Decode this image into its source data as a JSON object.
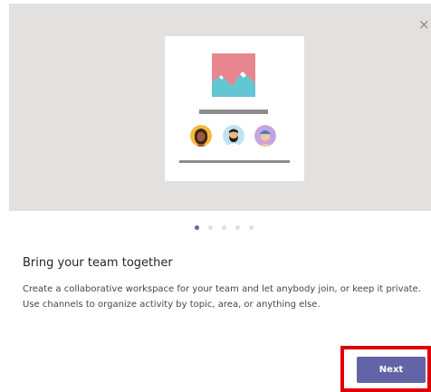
{
  "dialog": {
    "close_symbol": "×",
    "illustration": {
      "image_icon": "landscape-image-icon",
      "avatars": [
        "avatar-woman-icon",
        "avatar-bearded-man-icon",
        "avatar-man-with-cap-icon"
      ]
    },
    "pagination": {
      "total": 5,
      "current": 1
    },
    "heading": "Bring your team together",
    "body": "Create a collaborative workspace for your team and let anybody join, or keep it private. Use channels to organize activity by topic, area, or anything else.",
    "next_label": "Next"
  },
  "colors": {
    "accent": "#6264a7",
    "highlight": "#e00000",
    "hero_background": "#e2e1df"
  }
}
